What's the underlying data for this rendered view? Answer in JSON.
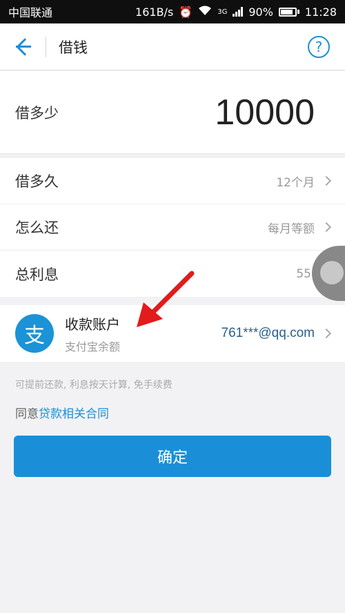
{
  "status_bar": {
    "carrier": "中国联通",
    "speed": "161B/s",
    "network": "3G",
    "battery": "90%",
    "time": "11:28"
  },
  "header": {
    "title": "借钱",
    "help_label": "?"
  },
  "amount": {
    "label": "借多少",
    "value": "10000"
  },
  "options": [
    {
      "label": "借多久",
      "value": "12个月"
    },
    {
      "label": "怎么还",
      "value": "每月等额"
    },
    {
      "label": "总利息",
      "value": "556.1"
    }
  ],
  "account": {
    "icon_glyph": "支",
    "title": "收款账户",
    "subtitle": "支付宝余额",
    "email": "761***@qq.com"
  },
  "note": "可提前还款, 利息按天计算, 免手续费",
  "agreement": {
    "prefix": "同意",
    "link": "贷款相关合同"
  },
  "confirm_label": "确定",
  "colors": {
    "accent": "#1a8fd8",
    "annotation": "#e31b1b"
  }
}
